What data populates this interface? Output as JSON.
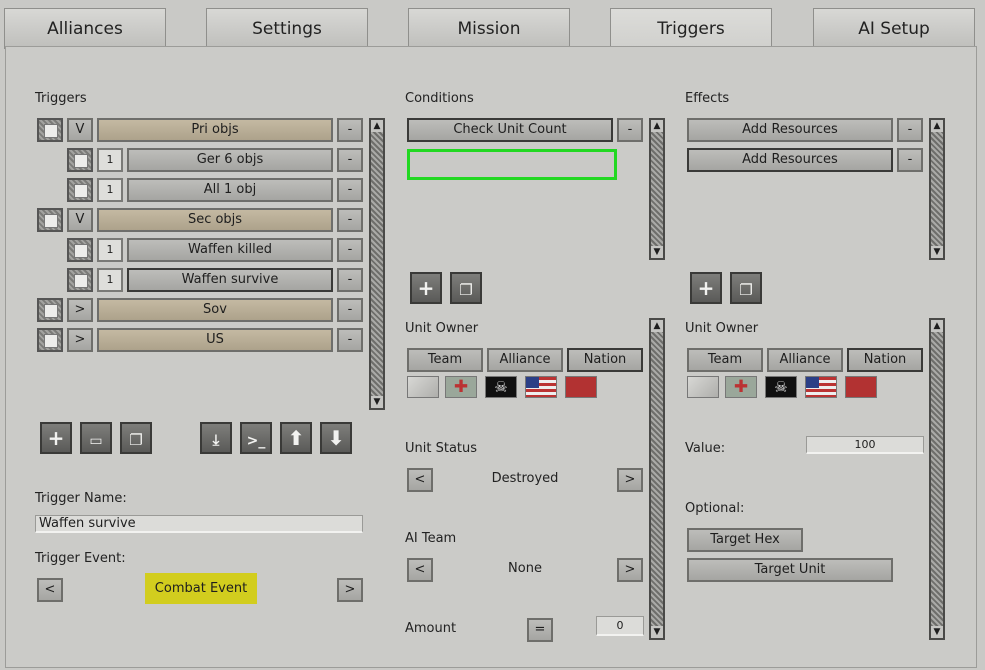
{
  "tabs": [
    "Alliances",
    "Settings",
    "Mission",
    "Triggers",
    "AI Setup"
  ],
  "triggers_panel": {
    "title": "Triggers",
    "rows": [
      {
        "toggle": "V",
        "label": "Pri objs",
        "level": 0,
        "count": ""
      },
      {
        "toggle": "",
        "label": "Ger 6 objs",
        "level": 1,
        "count": "1"
      },
      {
        "toggle": "",
        "label": "All 1 obj",
        "level": 1,
        "count": "1"
      },
      {
        "toggle": "V",
        "label": "Sec objs",
        "level": 0,
        "count": ""
      },
      {
        "toggle": "",
        "label": "Waffen killed",
        "level": 1,
        "count": "1"
      },
      {
        "toggle": "",
        "label": "Waffen survive",
        "level": 1,
        "count": "1"
      },
      {
        "toggle": ">",
        "label": "Sov",
        "level": 0,
        "count": ""
      },
      {
        "toggle": ">",
        "label": "US",
        "level": 0,
        "count": ""
      }
    ],
    "remove_label": "-",
    "trigger_name_label": "Trigger Name:",
    "trigger_name_value": "Waffen survive",
    "trigger_event_label": "Trigger Event:",
    "trigger_event_value": "Combat Event",
    "prev": "<",
    "next": ">"
  },
  "conditions_panel": {
    "title": "Conditions",
    "item": "Check Unit Count",
    "remove_label": "-",
    "unit_owner_label": "Unit Owner",
    "owner_tabs": [
      "Team",
      "Alliance",
      "Nation"
    ],
    "unit_status_label": "Unit Status",
    "unit_status_value": "Destroyed",
    "ai_team_label": "AI Team",
    "ai_team_value": "None",
    "amount_label": "Amount",
    "amount_op": "=",
    "amount_value": "0",
    "prev": "<",
    "next": ">"
  },
  "effects_panel": {
    "title": "Effects",
    "items": [
      "Add Resources",
      "Add Resources"
    ],
    "remove_label": "-",
    "unit_owner_label": "Unit Owner",
    "owner_tabs": [
      "Team",
      "Alliance",
      "Nation"
    ],
    "value_label": "Value:",
    "value": "100",
    "optional_label": "Optional:",
    "target_hex": "Target Hex",
    "target_unit": "Target Unit"
  },
  "nations": [
    "neutral",
    "germany",
    "ss-skull",
    "usa",
    "soviet"
  ],
  "colors": {
    "highlight_green": "#22d822",
    "event_yellow": "#d2cd1e"
  }
}
